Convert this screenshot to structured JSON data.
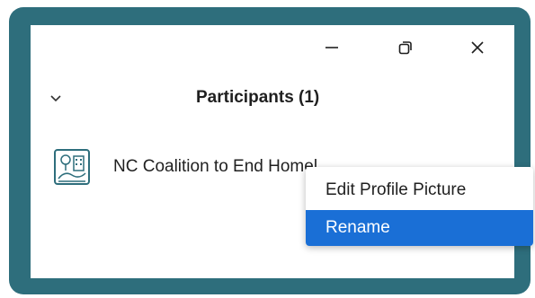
{
  "window": {
    "controls": {
      "minimize_icon": "minimize-icon",
      "restore_icon": "restore-icon",
      "close_icon": "close-icon"
    }
  },
  "panel": {
    "collapse_icon": "chevron-down-icon",
    "title": "Participants (1)"
  },
  "participants": [
    {
      "name": "NC Coalition to End Homelessness",
      "avatar_icon": "organization-logo-icon"
    }
  ],
  "context_menu": {
    "items": [
      {
        "label": "Edit Profile Picture",
        "selected": false
      },
      {
        "label": "Rename",
        "selected": true
      }
    ],
    "selected_color": "#1a6fd6"
  },
  "colors": {
    "frame": "#2e6e7c",
    "background": "#ffffff",
    "text": "#1f1f1f"
  }
}
